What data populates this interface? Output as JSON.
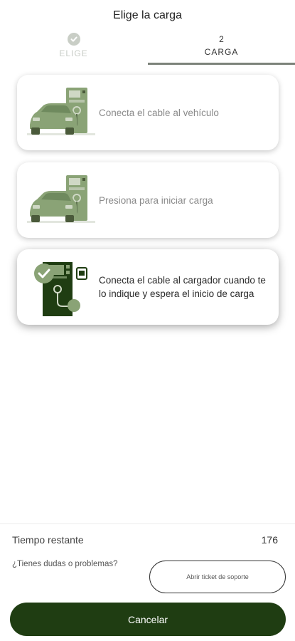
{
  "header": {
    "title": "Elige la carga"
  },
  "stepper": {
    "steps": [
      {
        "label": "ELIGE",
        "state": "completed",
        "icon": "check-icon"
      },
      {
        "number": "2",
        "label": "CARGA",
        "state": "active"
      }
    ]
  },
  "instructions": [
    {
      "text": "Conecta el cable al vehículo",
      "state": "inactive",
      "icon": "car-charger-icon"
    },
    {
      "text": "Presiona para iniciar carga",
      "state": "inactive",
      "icon": "car-charger-icon"
    },
    {
      "text": "Conecta el cable al cargador cuando te lo indique y espera el inicio de carga",
      "state": "active",
      "icon": "charger-plug-check-icon"
    }
  ],
  "footer": {
    "time_label": "Tiempo restante",
    "time_value": "176",
    "help_text": "¿Tienes dudas o problemas?",
    "ticket_button": "Abrir ticket de soporte",
    "cancel_button": "Cancelar"
  },
  "colors": {
    "brand_dark_green": "#1f3d12",
    "illustration_green": "#8aa376",
    "illustration_dark": "#2d4a1c",
    "inactive_text": "#8a8a8a"
  }
}
